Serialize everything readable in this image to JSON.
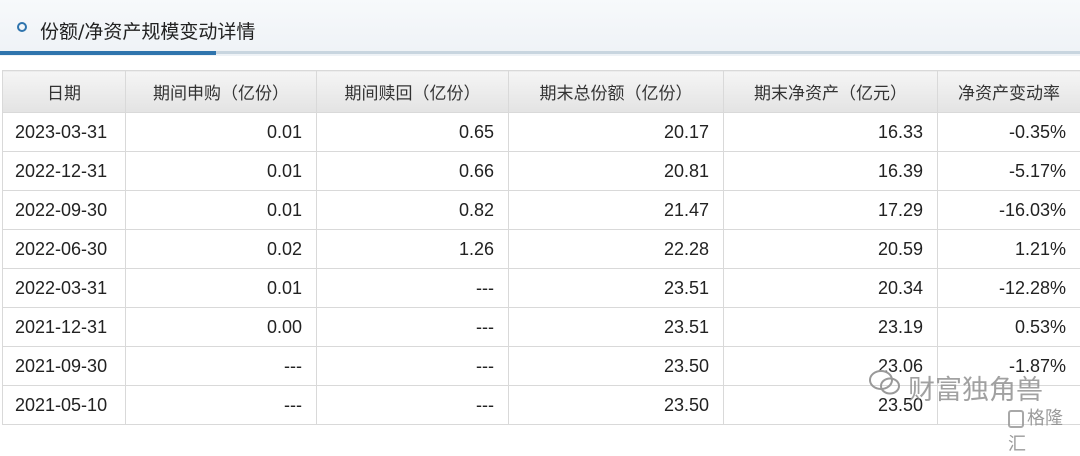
{
  "section": {
    "title": "份额/净资产规模变动详情"
  },
  "table": {
    "headers": [
      "日期",
      "期间申购（亿份）",
      "期间赎回（亿份）",
      "期末总份额（亿份）",
      "期末净资产（亿元）",
      "净资产变动率"
    ],
    "rows": [
      [
        "2023-03-31",
        "0.01",
        "0.65",
        "20.17",
        "16.33",
        "-0.35%"
      ],
      [
        "2022-12-31",
        "0.01",
        "0.66",
        "20.81",
        "16.39",
        "-5.17%"
      ],
      [
        "2022-09-30",
        "0.01",
        "0.82",
        "21.47",
        "17.29",
        "-16.03%"
      ],
      [
        "2022-06-30",
        "0.02",
        "1.26",
        "22.28",
        "20.59",
        "1.21%"
      ],
      [
        "2022-03-31",
        "0.01",
        "---",
        "23.51",
        "20.34",
        "-12.28%"
      ],
      [
        "2021-12-31",
        "0.00",
        "---",
        "23.51",
        "23.19",
        "0.53%"
      ],
      [
        "2021-09-30",
        "---",
        "---",
        "23.50",
        "23.06",
        "-1.87%"
      ],
      [
        "2021-05-10",
        "---",
        "---",
        "23.50",
        "23.50",
        ""
      ]
    ]
  },
  "watermark": {
    "text": "财富独角兽",
    "logo_text": "格隆汇"
  },
  "colors": {
    "accent": "#2f74ad",
    "header_bg": "#e8e8e8"
  }
}
